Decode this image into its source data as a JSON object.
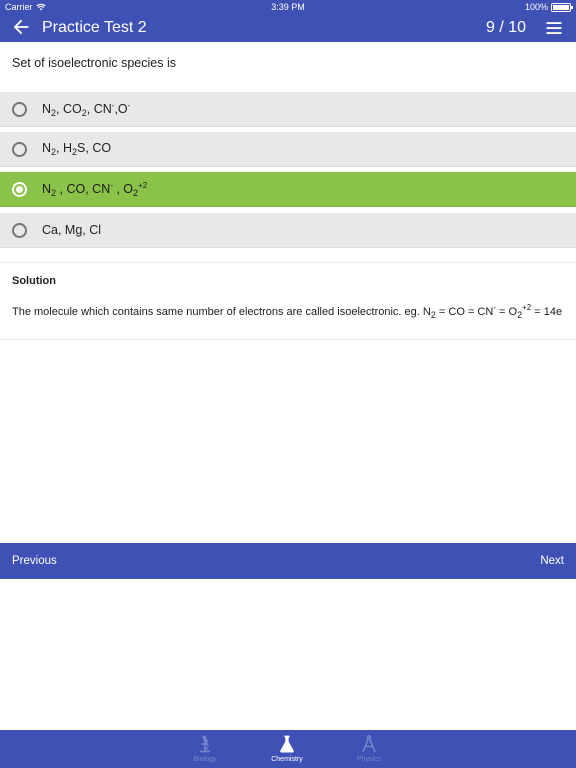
{
  "status_bar": {
    "carrier": "Carrier",
    "time": "3:39 PM",
    "battery": "100%"
  },
  "app_bar": {
    "title": "Practice Test 2",
    "counter": "9 / 10"
  },
  "question": {
    "text": "Set of isoelectronic species is"
  },
  "options": [
    {
      "id": "a",
      "selected": false
    },
    {
      "id": "b",
      "selected": false
    },
    {
      "id": "c",
      "selected": true
    },
    {
      "id": "d",
      "selected": false,
      "text": "Ca, Mg, Cl"
    }
  ],
  "solution": {
    "heading": "Solution",
    "text_prefix": "The molecule which contains same number of electrons are called isoelectronic. eg. N",
    "text_suffix": " = 14e"
  },
  "navigation": {
    "previous": "Previous",
    "next": "Next"
  },
  "tabs": [
    {
      "label": "Biology",
      "icon": "microscope-icon",
      "active": false
    },
    {
      "label": "Chemistry",
      "icon": "flask-icon",
      "active": true
    },
    {
      "label": "Physics",
      "icon": "compass-icon",
      "active": false
    }
  ],
  "colors": {
    "primary": "#3f51b5",
    "selected_option": "#8bc34a",
    "option_bg": "#e8e8e8",
    "inactive_tab": "#7986cb"
  }
}
